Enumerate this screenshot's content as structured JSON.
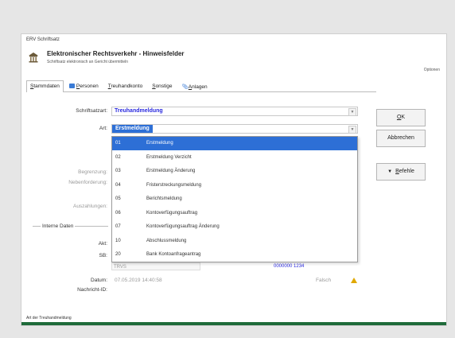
{
  "window": {
    "title": "ERV Schriftsatz",
    "header_title": "Elektronischer Rechtsverkehr - Hinweisfelder",
    "header_subtitle": "Schriftsatz elektronisch an Gericht übermitteln",
    "optionen": "Optionen"
  },
  "tabs": [
    {
      "label": "Stammdaten",
      "underline": "S",
      "rest": "tammdaten"
    },
    {
      "label": "Personen",
      "underline": "P",
      "rest": "ersonen"
    },
    {
      "label": "Treuhandkonto",
      "underline": "T",
      "rest": "reuhandkonto"
    },
    {
      "label": "Sonstige",
      "underline": "S",
      "rest": "onstige"
    },
    {
      "label": "Anlagen",
      "underline": "A",
      "rest": "nlagen"
    }
  ],
  "form": {
    "schriftsatzart_label": "Schriftsatzart:",
    "schriftsatzart_value": "Treuhandmeldung",
    "art_label": "Art:",
    "art_value": "Erstmeldung",
    "begrenzung_label": "Begrenzung:",
    "nebenforderung_label": "Nebenforderung:",
    "auszahlungen_label": "Auszahlungen:",
    "interne_daten_label": "Interne Daten",
    "akt_label": "Akt:",
    "sb_label": "SB:",
    "sb_value": "TRVS",
    "right_blue_value": "0000000 1234",
    "datum_label": "Datum:",
    "datum_value": "07.05.2019 14:40:58",
    "falsch_label": "Falsch",
    "nachricht_label": "Nachricht-ID:"
  },
  "dropdown_items": [
    {
      "code": "01",
      "text": "Erstmeldung",
      "selected": true
    },
    {
      "code": "02",
      "text": "Erstmeldung Verzicht",
      "selected": false
    },
    {
      "code": "03",
      "text": "Erstmeldung Änderung",
      "selected": false
    },
    {
      "code": "04",
      "text": "Fristerstreckungsmeldung",
      "selected": false
    },
    {
      "code": "05",
      "text": "Berichtsmeldung",
      "selected": false
    },
    {
      "code": "06",
      "text": "Kontoverfügungsauftrag",
      "selected": false
    },
    {
      "code": "07",
      "text": "Kontoverfügungsauftrag Änderung",
      "selected": false
    },
    {
      "code": "10",
      "text": "Abschlussmeldung",
      "selected": false
    },
    {
      "code": "20",
      "text": "Bank Kontoanfrageantrag",
      "selected": false
    }
  ],
  "buttons": {
    "ok_u": "O",
    "ok_rest": "K",
    "abbrechen": "Abbrechen",
    "befehle_u": "B",
    "befehle_rest": "efehle"
  },
  "status_text": "Art der Treuhandmeldung",
  "colors": {
    "accent": "#2d6fd6",
    "value_blue": "#2a2adf",
    "status_bar": "#1f6b3a",
    "warning": "#e0a800"
  }
}
